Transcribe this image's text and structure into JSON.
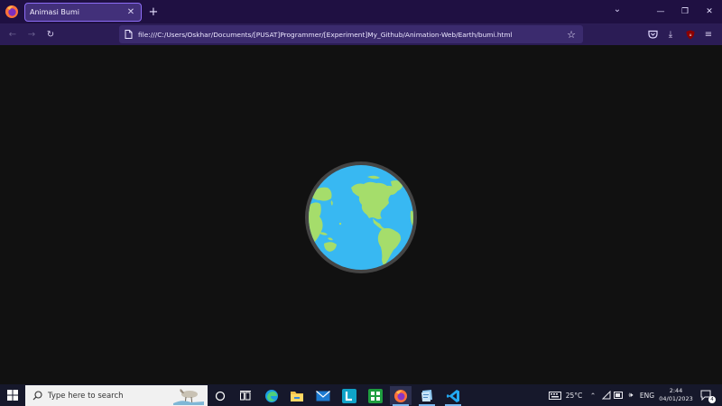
{
  "browser": {
    "tab": {
      "title": "Animasi Bumi"
    },
    "url": "file:///C:/Users/Oskhar/Documents/[PUSAT]Programmer/[Experiment]My_Github/Animation-Web/Earth/bumi.html"
  },
  "taskbar": {
    "search_placeholder": "Type here to search",
    "temperature": "25°C",
    "language": "ENG",
    "time": "2:44",
    "date": "04/01/2023",
    "notification_count": "4"
  },
  "colors": {
    "ocean": "#38b8f2",
    "land": "#a5dd6b",
    "rim": "#444444",
    "background": "#111111"
  }
}
